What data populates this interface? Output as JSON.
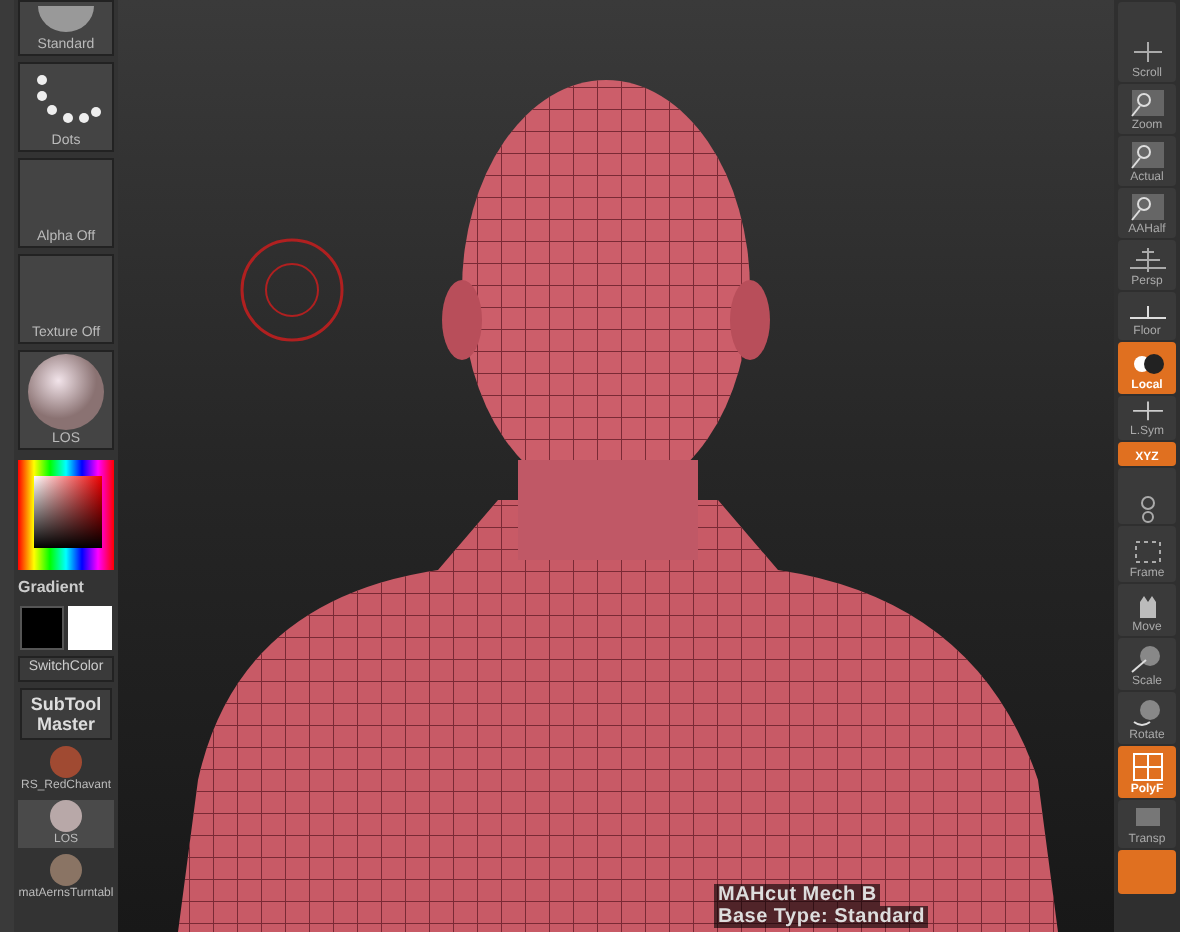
{
  "left_panel": {
    "tiles": [
      {
        "kind": "brush",
        "label": "Standard"
      },
      {
        "kind": "dots",
        "label": "Dots"
      },
      {
        "kind": "empty",
        "label": "Alpha Off"
      },
      {
        "kind": "empty",
        "label": "Texture Off"
      },
      {
        "kind": "sphere",
        "label": "LOS"
      }
    ],
    "color_label": "Gradient",
    "switch_color": "SwitchColor",
    "subtool_master": "SubTool Master",
    "materials": [
      {
        "label": "RS_RedChavant",
        "color": "#a04a32",
        "selected": false
      },
      {
        "label": "LOS",
        "color": "#b8a8a8",
        "selected": true
      },
      {
        "label": "matAernsTurntabl",
        "color": "#8a7464",
        "selected": false
      }
    ]
  },
  "right_toolbar": [
    {
      "kind": "scroll",
      "label": "Scroll",
      "active": false
    },
    {
      "kind": "zoom",
      "label": "Zoom",
      "active": false
    },
    {
      "kind": "actual",
      "label": "Actual",
      "active": false
    },
    {
      "kind": "aahalf",
      "label": "AAHalf",
      "active": false
    },
    {
      "kind": "persp",
      "label": "Persp",
      "active": false
    },
    {
      "kind": "floor",
      "label": "Floor",
      "active": false
    },
    {
      "kind": "local",
      "label": "Local",
      "active": true
    },
    {
      "kind": "lsym",
      "label": "L.Sym",
      "active": false
    },
    {
      "kind": "xyz",
      "label": "XYZ",
      "active": true
    },
    {
      "kind": "rotate_small",
      "active": false
    },
    {
      "kind": "frame",
      "label": "Frame",
      "active": false
    },
    {
      "kind": "move",
      "label": "Move",
      "active": false
    },
    {
      "kind": "scale",
      "label": "Scale",
      "active": false
    },
    {
      "kind": "rotate",
      "label": "Rotate",
      "active": false
    },
    {
      "kind": "polyf",
      "label": "PolyF",
      "active": true
    },
    {
      "kind": "transp",
      "label": "Transp",
      "active": false
    },
    {
      "kind": "blank",
      "active": true
    }
  ],
  "status": [
    "MAHcut Mech B",
    "Base Type: Standard"
  ]
}
